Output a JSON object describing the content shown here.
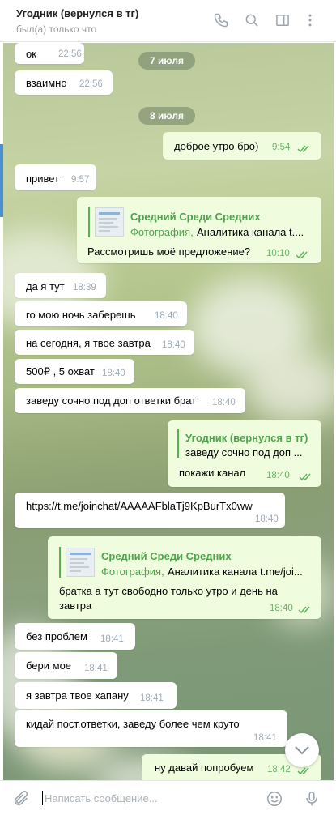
{
  "header": {
    "title": "Угодник (вернулся в тг)",
    "status": "был(а) только что",
    "icons": [
      "phone-icon",
      "search-icon",
      "sidebar-icon",
      "more-icon"
    ]
  },
  "dates": [
    "7 июля",
    "8 июля"
  ],
  "messages": [
    {
      "dir": "in",
      "text": "ок",
      "time": "22:56"
    },
    {
      "dir": "in",
      "text": "взаимно",
      "time": "22:56"
    },
    {
      "dir": "out",
      "text": "доброе утро бро)",
      "time": "9:54"
    },
    {
      "dir": "in",
      "text": "привет",
      "time": "9:57"
    },
    {
      "dir": "out",
      "link_title": "Средний Среди Средних",
      "link_prefix": "Фотография,",
      "link_desc": "Аналитика канала t....",
      "text": "Рассмотришь моё предложение?",
      "time": "10:10"
    },
    {
      "dir": "in",
      "text": "да я тут",
      "time": "18:39"
    },
    {
      "dir": "in",
      "text": "го мою ночь заберешь",
      "time": "18:40"
    },
    {
      "dir": "in",
      "text": "на сегодня, я твое завтра",
      "time": "18:40"
    },
    {
      "dir": "in",
      "text": "500₽ , 5 охват",
      "time": "18:40"
    },
    {
      "dir": "in",
      "text": "заведу сочно под доп ответки брат",
      "time": "18:40"
    },
    {
      "dir": "out",
      "reply_name": "Угодник (вернулся в тг)",
      "reply_text": "заведу сочно под доп ...",
      "text": "покажи канал",
      "time": "18:40"
    },
    {
      "dir": "in",
      "text": "https://t.me/joinchat/AAAAAFblaTj9KpBurTx0ww",
      "time": "18:40"
    },
    {
      "dir": "out",
      "link_title": "Средний Среди Средних",
      "link_prefix": "Фотография,",
      "link_desc": "Аналитика канала t.me/joi...",
      "text": "братка а тут свободно только утро и день на",
      "text2": "завтра",
      "time": "18:40"
    },
    {
      "dir": "in",
      "text": "без проблем",
      "time": "18:41"
    },
    {
      "dir": "in",
      "text": "бери мое",
      "time": "18:41"
    },
    {
      "dir": "in",
      "text": "я завтра твое хапану",
      "time": "18:41"
    },
    {
      "dir": "in",
      "text": "кидай пост,ответки, заведу более чем круто",
      "time": "18:41"
    },
    {
      "dir": "out",
      "text": "ну давай попробуем",
      "time": "18:42"
    }
  ],
  "composer": {
    "placeholder": "Написать сообщение..."
  },
  "colors": {
    "outgoing_bubble": "#effdde",
    "incoming_bubble": "#ffffff",
    "accent_green": "#4fa34b",
    "link_blue": "#2a7dcc"
  }
}
